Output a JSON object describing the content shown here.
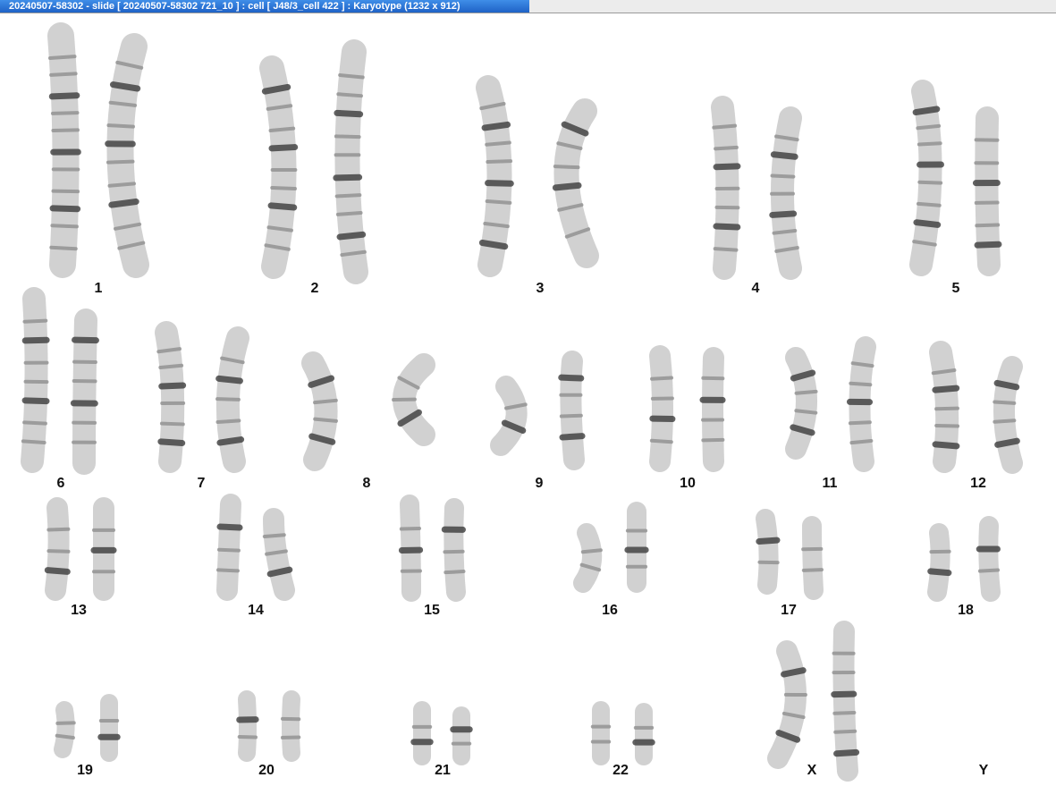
{
  "window": {
    "title": "20240507-58302 - slide [ 20240507-58302 721_10 ] : cell [ J48/3_cell 422 ] : Karyotype  (1232 x 912)"
  },
  "karyotype": {
    "labels": [
      "1",
      "2",
      "3",
      "4",
      "5",
      "6",
      "7",
      "8",
      "9",
      "10",
      "11",
      "12",
      "13",
      "14",
      "15",
      "16",
      "17",
      "18",
      "19",
      "20",
      "21",
      "22",
      "X",
      "Y"
    ]
  },
  "colors": {
    "chromosome_fill": "#c9c9c9",
    "band_dark": "#3c3c3c",
    "band_light": "#8f8f8f",
    "titlebar_accent": "#2a72d6"
  }
}
